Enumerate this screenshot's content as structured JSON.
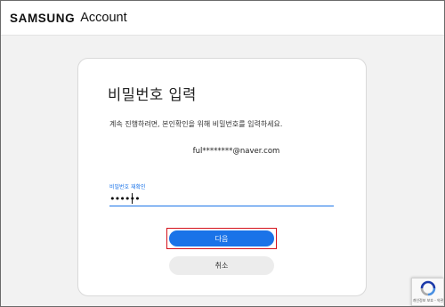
{
  "header": {
    "brand": "SAMSUNG",
    "product": "Account"
  },
  "card": {
    "title": "비밀번호 입력",
    "description": "계속 진행하려면, 본인확인을 위해 비밀번호를 입력하세요.",
    "email": "ful********@naver.com",
    "password_label": "비밀번호 재확인",
    "password_value": "••••••",
    "next_label": "다음",
    "cancel_label": "취소"
  },
  "recaptcha": {
    "text": "개인정보 보호 - 약관",
    "icon": "recaptcha-icon"
  },
  "colors": {
    "primary": "#1a73e8",
    "highlight": "#d4101a",
    "background": "#f2f2f2",
    "cancel_bg": "#ececec"
  }
}
